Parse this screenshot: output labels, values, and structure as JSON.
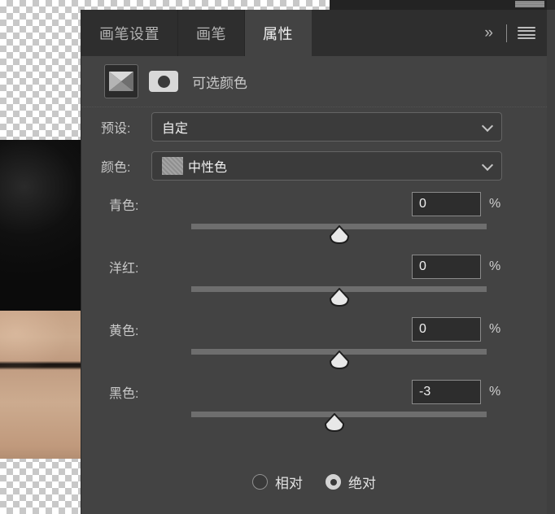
{
  "panel": {
    "tabs": [
      {
        "label": "画笔设置",
        "active": false
      },
      {
        "label": "画笔",
        "active": false
      },
      {
        "label": "属性",
        "active": true
      }
    ],
    "tools": {
      "collapse_label": "»",
      "menu_label": "menu"
    },
    "adjustment": {
      "title": "可选颜色",
      "layer_icon": "selective-color-icon",
      "mask_icon": "layer-mask-icon"
    },
    "selects": [
      {
        "name": "preset",
        "label": "预设:",
        "value": "自定",
        "swatch": null
      },
      {
        "name": "colors",
        "label": "颜色:",
        "value": "中性色",
        "swatch": "#9a9a9a"
      }
    ],
    "sliders": [
      {
        "name": "cyan",
        "label": "青色:",
        "value": "0",
        "unit": "%",
        "percent": 50.0
      },
      {
        "name": "magenta",
        "label": "洋红:",
        "value": "0",
        "unit": "%",
        "percent": 50.0
      },
      {
        "name": "yellow",
        "label": "黄色:",
        "value": "0",
        "unit": "%",
        "percent": 50.0
      },
      {
        "name": "black",
        "label": "黑色:",
        "value": "-3",
        "unit": "%",
        "percent": 48.5
      }
    ],
    "method": {
      "options": [
        {
          "label": "相对",
          "selected": false
        },
        {
          "label": "绝对",
          "selected": true
        }
      ]
    }
  },
  "colors": {
    "panel_bg": "#434343",
    "tabbar_bg": "#2e2e2e",
    "active_tab_bg": "#434343",
    "field_bg": "#3b3b3b",
    "input_bg": "#2d2d2d",
    "track": "#6e6e6e",
    "thumb": "#e8e8e8",
    "text": "#c9c9c9",
    "text_bright": "#f0f0f0"
  }
}
